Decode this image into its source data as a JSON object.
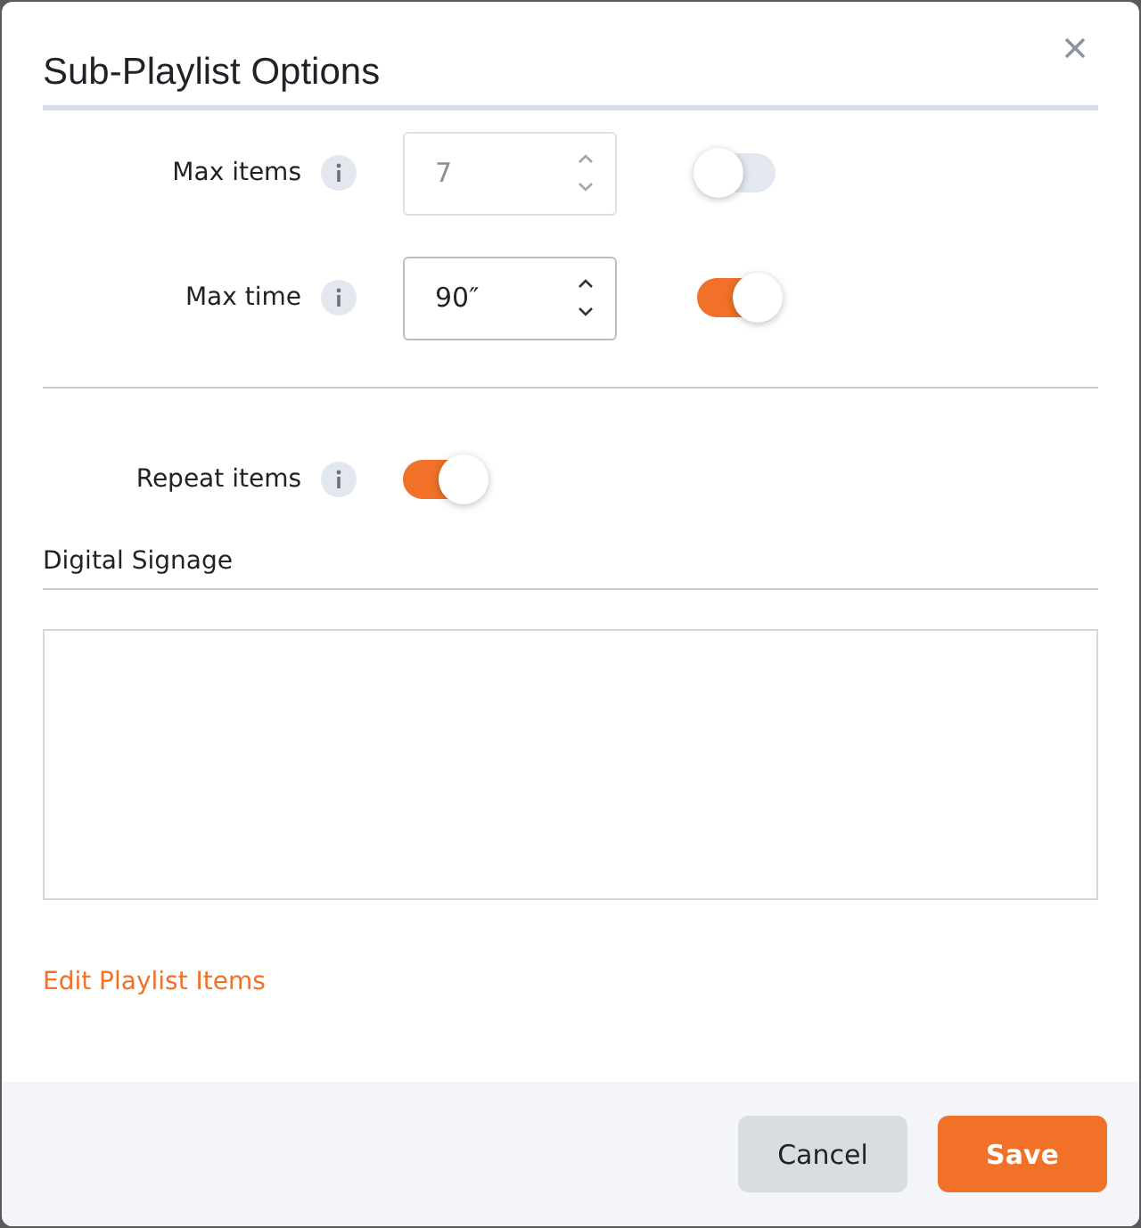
{
  "dialog": {
    "title": "Sub-Playlist Options"
  },
  "limits": [
    {
      "label": "Max items",
      "value": "7",
      "disabled": true,
      "on": false
    },
    {
      "label": "Max time",
      "value": "90″",
      "disabled": false,
      "on": true
    }
  ],
  "repeat": {
    "label": "Repeat items",
    "on": true
  },
  "section": {
    "title": "Digital Signage"
  },
  "link": "Edit Playlist Items",
  "buttons": [
    {
      "label": "Cancel",
      "kind": "secondary"
    },
    {
      "label": "Save",
      "kind": "primary"
    }
  ]
}
